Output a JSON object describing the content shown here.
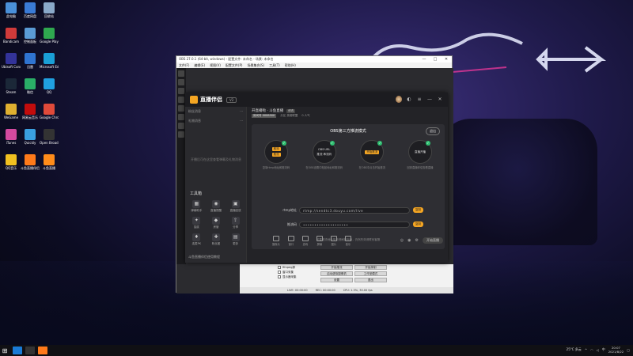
{
  "desktop": {
    "icons": [
      {
        "label": "此电脑",
        "color": "#4a90d9"
      },
      {
        "label": "百度网盘",
        "color": "#3a7bd5"
      },
      {
        "label": "回收站",
        "color": "#8aa9c9"
      },
      {
        "label": "Bandicam",
        "color": "#d03a3a"
      },
      {
        "label": "控制面板",
        "color": "#5a9bd5"
      },
      {
        "label": "Google Play",
        "color": "#2fa84f"
      },
      {
        "label": "Ubisoft Connect",
        "color": "#333399"
      },
      {
        "label": "迅雷",
        "color": "#2f74d0"
      },
      {
        "label": "Microsoft Edge",
        "color": "#1a9fd6"
      },
      {
        "label": "Steam",
        "color": "#1b2838"
      },
      {
        "label": "微信",
        "color": "#2aae67"
      },
      {
        "label": "QQ",
        "color": "#20a0e0"
      },
      {
        "label": "WeGame",
        "color": "#e0b030"
      },
      {
        "label": "网易云音乐",
        "color": "#c20c0c"
      },
      {
        "label": "Google Chrome",
        "color": "#e04a3a"
      },
      {
        "label": "iTunes",
        "color": "#d34aa0"
      },
      {
        "label": "Quickly",
        "color": "#3aa0e0"
      },
      {
        "label": "Open Broadcaster",
        "color": "#333"
      },
      {
        "label": "QQ音乐",
        "color": "#f0c020"
      },
      {
        "label": "斗鱼直播伴侣",
        "color": "#ff7a1a"
      },
      {
        "label": "斗鱼直播",
        "color": "#ff8c1a"
      }
    ]
  },
  "obs": {
    "title": "OBS 27.0.1 (64-bit, windows) - 配置文件: 未命名 - 场景: 未命名",
    "menu": [
      "文件(F)",
      "编辑(E)",
      "视图(V)",
      "配置文件(P)",
      "场景集合(S)",
      "工具(T)",
      "帮助(H)"
    ],
    "window_controls": [
      "—",
      "□",
      "✕"
    ],
    "scenes": [
      "ffmpeg源",
      "窗口采集",
      "显示器采集"
    ],
    "controls": [
      "开始推流",
      "开始录制",
      "启动虚拟摄像机",
      "工作室模式",
      "设置",
      "退出"
    ],
    "status": [
      "LIVE: 00:00:00",
      "REC: 00:00:00",
      "CPU: 1.3%, 30.00 fps"
    ]
  },
  "plugin": {
    "logo_text": "直播伴侣",
    "version": "V2",
    "header_icons": [
      "skin-icon",
      "menu-icon",
      "minimize-icon",
      "close-icon"
    ],
    "room_title": "开直播啦 · 斗鱼直播",
    "room_tag": "修改",
    "room_meta": [
      "房间号 8888888",
      "分区 英雄联盟",
      "0 人气"
    ],
    "side_rows": [
      {
        "left": "粉丝消息",
        "right": "···"
      },
      {
        "left": "礼物消息",
        "right": "···"
      }
    ],
    "side_note": "开播后可在这里查看弹幕及礼物消息",
    "toolbox_title": "工具箱",
    "tools": [
      {
        "label": "弹幕助手",
        "glyph": "▦"
      },
      {
        "label": "直播提醒",
        "glyph": "◉"
      },
      {
        "label": "直播回放",
        "glyph": "▣"
      },
      {
        "label": "抽奖",
        "glyph": "✦"
      },
      {
        "label": "房管",
        "glyph": "◆"
      },
      {
        "label": "分享",
        "glyph": "⇪"
      },
      {
        "label": "连麦PK",
        "glyph": "♦"
      },
      {
        "label": "粉丝团",
        "glyph": "✚"
      },
      {
        "label": "更多",
        "glyph": "▤"
      }
    ],
    "side_footer": "斗鱼直播伴侣使用教程",
    "card_title": "OBS第三方推流模式",
    "exit_label": "退出",
    "steps": [
      {
        "chips": [
          "推流",
          "推流"
        ],
        "text": "",
        "label": "复制rtmp地址和推流码"
      },
      {
        "chips": [],
        "text": "OBS·URL",
        "text2": "推流·串流码",
        "label": "在OBS设置中粘贴地址和推流码"
      },
      {
        "chips": [
          "开始推流"
        ],
        "text": "",
        "label": "在OBS中点击开始推流"
      },
      {
        "chips": [],
        "text": "直播开播",
        "text2": "",
        "label": "回到直播伴侣查看直播"
      }
    ],
    "arrow": "→ →",
    "rtmp_label": "rtmp地址",
    "rtmp_value": "rtmp://sendtc3.douyu.com/live",
    "key_label": "推流码",
    "key_value": "••••••••••••••••••••",
    "copy_label": "复制",
    "hint": "如果推流地址失效请刷新页面，仍然失效请联系客服",
    "bottom_items": [
      "摄像头",
      "窗口",
      "游戏",
      "屏幕",
      "图片",
      "音乐"
    ],
    "go_live": "开始直播"
  },
  "taskbar": {
    "weather": "25°C 多云",
    "time": "20:07",
    "date": "2021/8/22",
    "lang": "中"
  }
}
